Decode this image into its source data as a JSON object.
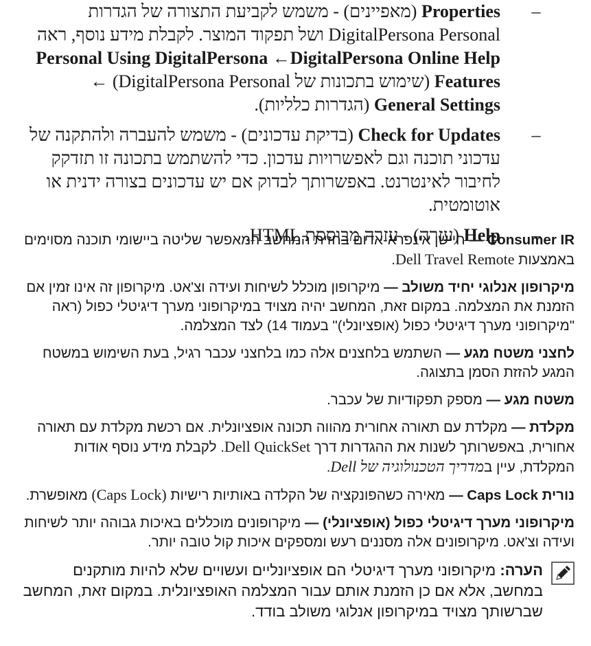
{
  "bullets": [
    {
      "term": "Properties",
      "term_he": "(מאפיינים)",
      "line1_rest": " - משמש לקביעת התצורה של הגדרות",
      "line2": "DigitalPersona Personal ושל תפקוד המוצר. לקבלת מידע נוסף,",
      "line3_a": "ראה ",
      "line3_bold": "Using DigitalPersona ←DigitalPersona Online Help",
      "line4_bold": "Personal Features",
      "line4_rest": " (שימוש בתכונות של DigitalPersona",
      "line5_a": "Personal) ← ",
      "line5_bold": "General Settings",
      "line5_rest": " (הגדרות כלליות)."
    },
    {
      "term": "Check for Updates",
      "term_he": "(בדיקת עדכונים)",
      "line1_rest": " - משמש להעברה ולהתקנה של",
      "line2": "עדכוני תוכנה וגם לאפשרויות עדכון. כדי להשתמש בתכונה זו תזדקק לחיבור",
      "line3": "לאינטרנט. באפשרותך לבדוק אם יש עדכונים בצורה ידנית או אוטומטית."
    },
    {
      "term": "Help",
      "term_he": "(עזרה)",
      "line1_rest": " - עזרה מבוססת HTML."
    }
  ],
  "definitions": [
    {
      "term": "Consumer IR —",
      "text_a": " חיישן אינפרא-אדום בחזית המחשב המאפשר שליטה ביישומי תוכנה מסוימים באמצעות ",
      "text_serif": "Dell Travel Remote",
      "text_b": "."
    },
    {
      "term": "מיקרופון אנלוגי יחיד משולב —",
      "text_a": " מיקרופון מוכלל לשיחות ועידה וצ'אט. מיקרופון זה אינו זמין אם הזמנת את המצלמה. במקום זאת, המחשב יהיה מצויד במיקרופוני מערך דיגיטלי כפול (ראה \"מיקרופוני מערך דיגיטלי כפול (אופציונלי)\" בעמוד 14) לצד המצלמה."
    },
    {
      "term": "לחצני משטח מגע —",
      "text_a": " השתמש בלחצנים אלה כמו בלחצני עכבר רגיל, בעת השימוש במשטח המגע להזזת הסמן בתצוגה."
    },
    {
      "term": "משטח מגע —",
      "text_a": " מספק תפקודיות של עכבר."
    },
    {
      "term": "מקלדת —",
      "text_a": " מקלדת עם תאורה אחורית מהווה תכונה אופציונלית. אם רכשת מקלדת עם תאורה אחורית, באפשרותך לשנות את ההגדרות דרך ",
      "text_serif": "Dell QuickSet",
      "text_b": ". לקבלת מידע נוסף אודות המקלדת, עיין ב",
      "text_italic": "מדריך הטכנולוגיה של Dell",
      "text_c": "."
    },
    {
      "term": "נורית Caps Lock —",
      "text_a": " מאירה כשהפונקציה של הקלדה באותיות רישיות ",
      "text_serif": "(Caps Lock)",
      "text_b": " מאופשרת."
    },
    {
      "term": "מיקרופוני מערך דיגיטלי כפול (אופציונלי) —",
      "text_a": " מיקרופונים מוכללים באיכות גבוהה יותר לשיחות ועידה וצ'אט. מיקרופונים אלה מסננים רעש ומספקים איכות קול טובה יותר."
    }
  ],
  "note": {
    "label": "הערה:",
    "text": " מיקרופוני מערך דיגיטלי הם אופציונליים ועשויים שלא להיות מותקנים במחשב, אלא אם כן הזמנת אותם עבור המצלמה האופציונלית. במקום זאת, המחשב שברשותך מצויד במיקרופון אנלוגי משולב בודד."
  },
  "bullet_marker": "–"
}
